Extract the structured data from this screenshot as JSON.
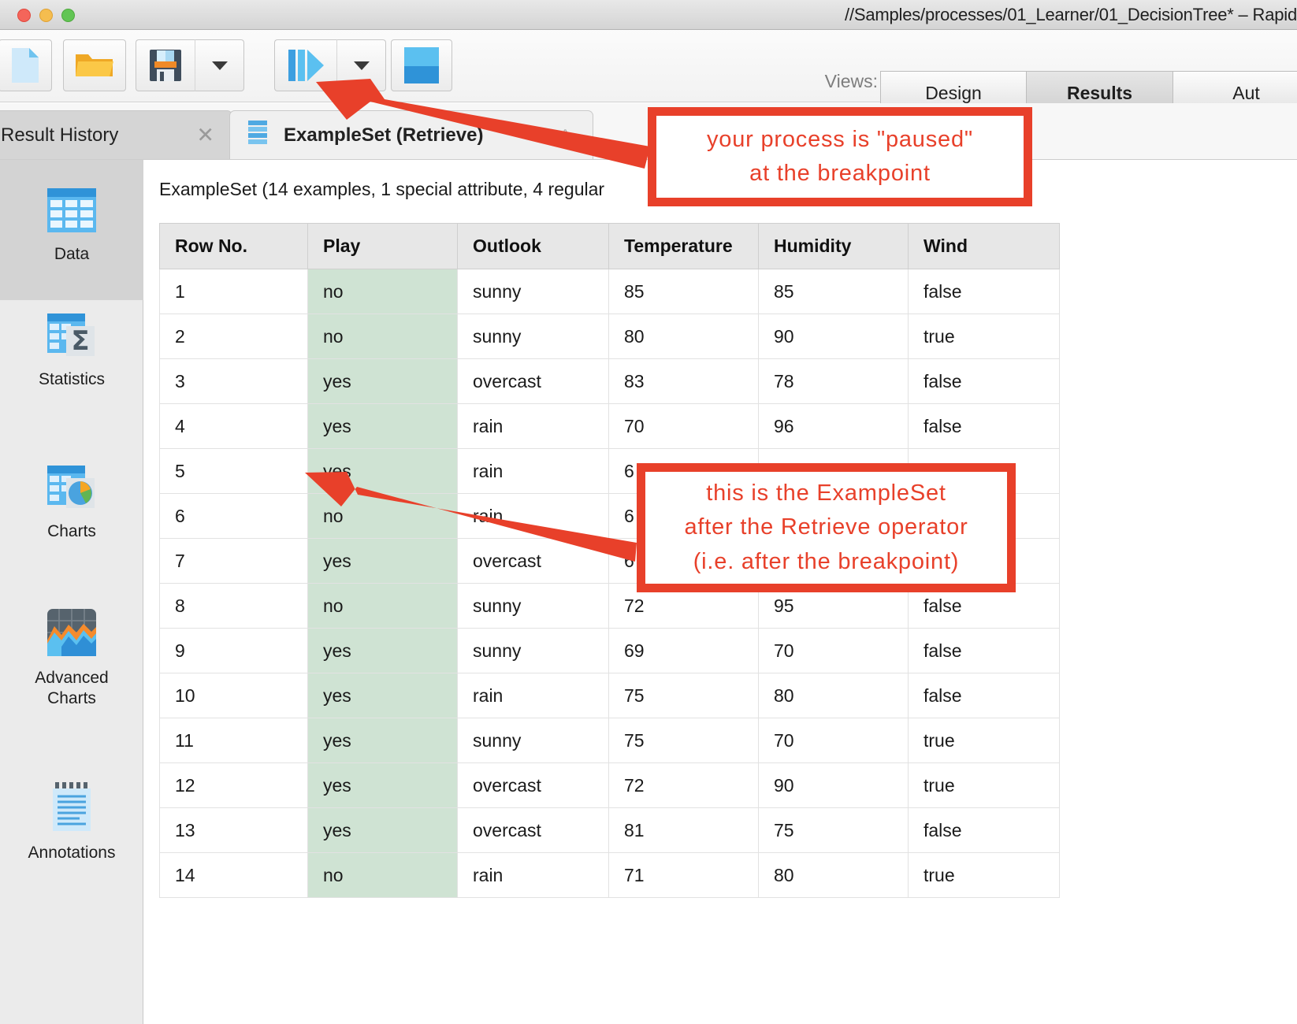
{
  "window": {
    "title": "//Samples/processes/01_Learner/01_DecisionTree* – Rapid",
    "traffic_lights": [
      "close",
      "minimize",
      "maximize"
    ]
  },
  "toolbar": {
    "buttons": [
      {
        "name": "new-process-button",
        "icon": "new-file-icon"
      },
      {
        "name": "open-process-button",
        "icon": "open-folder-icon"
      },
      {
        "name": "save-process-button",
        "icon": "floppy-save-icon"
      },
      {
        "name": "save-dropdown-button",
        "icon": "chevron-down-icon"
      },
      {
        "name": "run-process-button",
        "icon": "play-pause-step-icon"
      },
      {
        "name": "run-dropdown-button",
        "icon": "chevron-down-icon"
      },
      {
        "name": "stop-process-button",
        "icon": "stop-square-icon"
      }
    ],
    "views_label": "Views:",
    "view_tabs": [
      {
        "label": "Design",
        "active": false
      },
      {
        "label": "Results",
        "active": true
      },
      {
        "label": "Aut",
        "active": false
      }
    ]
  },
  "result_tabs": [
    {
      "label": "Result History",
      "active": false,
      "closable": true
    },
    {
      "label": "ExampleSet (Retrieve)",
      "active": true,
      "closable": false,
      "icon": "dataset-icon"
    }
  ],
  "sidebar": {
    "items": [
      {
        "label": "Data",
        "icon": "table-grid-icon",
        "selected": true
      },
      {
        "label": "Statistics",
        "icon": "sigma-table-icon",
        "selected": false
      },
      {
        "label": "Charts",
        "icon": "pie-chart-table-icon",
        "selected": false
      },
      {
        "label": "Advanced\nCharts",
        "icon": "area-chart-icon",
        "selected": false
      },
      {
        "label": "Annotations",
        "icon": "notepad-icon",
        "selected": false
      }
    ]
  },
  "main": {
    "exampleset_summary": "ExampleSet (14 examples, 1 special attribute, 4 regular",
    "table": {
      "columns": [
        "Row No.",
        "Play",
        "Outlook",
        "Temperature",
        "Humidity",
        "Wind"
      ],
      "rows": [
        [
          "1",
          "no",
          "sunny",
          "85",
          "85",
          "false"
        ],
        [
          "2",
          "no",
          "sunny",
          "80",
          "90",
          "true"
        ],
        [
          "3",
          "yes",
          "overcast",
          "83",
          "78",
          "false"
        ],
        [
          "4",
          "yes",
          "rain",
          "70",
          "96",
          "false"
        ],
        [
          "5",
          "yes",
          "rain",
          "6",
          "",
          ""
        ],
        [
          "6",
          "no",
          "rain",
          "6",
          "",
          ""
        ],
        [
          "7",
          "yes",
          "overcast",
          "6",
          "",
          ""
        ],
        [
          "8",
          "no",
          "sunny",
          "72",
          "95",
          "false"
        ],
        [
          "9",
          "yes",
          "sunny",
          "69",
          "70",
          "false"
        ],
        [
          "10",
          "yes",
          "rain",
          "75",
          "80",
          "false"
        ],
        [
          "11",
          "yes",
          "sunny",
          "75",
          "70",
          "true"
        ],
        [
          "12",
          "yes",
          "overcast",
          "72",
          "90",
          "true"
        ],
        [
          "13",
          "yes",
          "overcast",
          "81",
          "75",
          "false"
        ],
        [
          "14",
          "no",
          "rain",
          "71",
          "80",
          "true"
        ]
      ]
    }
  },
  "annotations": {
    "accent_color": "#e8402a",
    "boxes": [
      {
        "name": "breakpoint-callout",
        "lines": [
          "your process is \"paused\"",
          "at the breakpoint"
        ]
      },
      {
        "name": "exampleset-callout",
        "lines": [
          "this is the ExampleSet",
          "after the Retrieve operator",
          "(i.e. after the breakpoint)"
        ]
      }
    ]
  },
  "colors": {
    "play_cell_green": "#cfe3d3",
    "header_grey": "#e7e7e7",
    "sidebar_grey": "#ebebeb",
    "selected_grey": "#d3d3d3",
    "annotation_red": "#e8402a"
  }
}
